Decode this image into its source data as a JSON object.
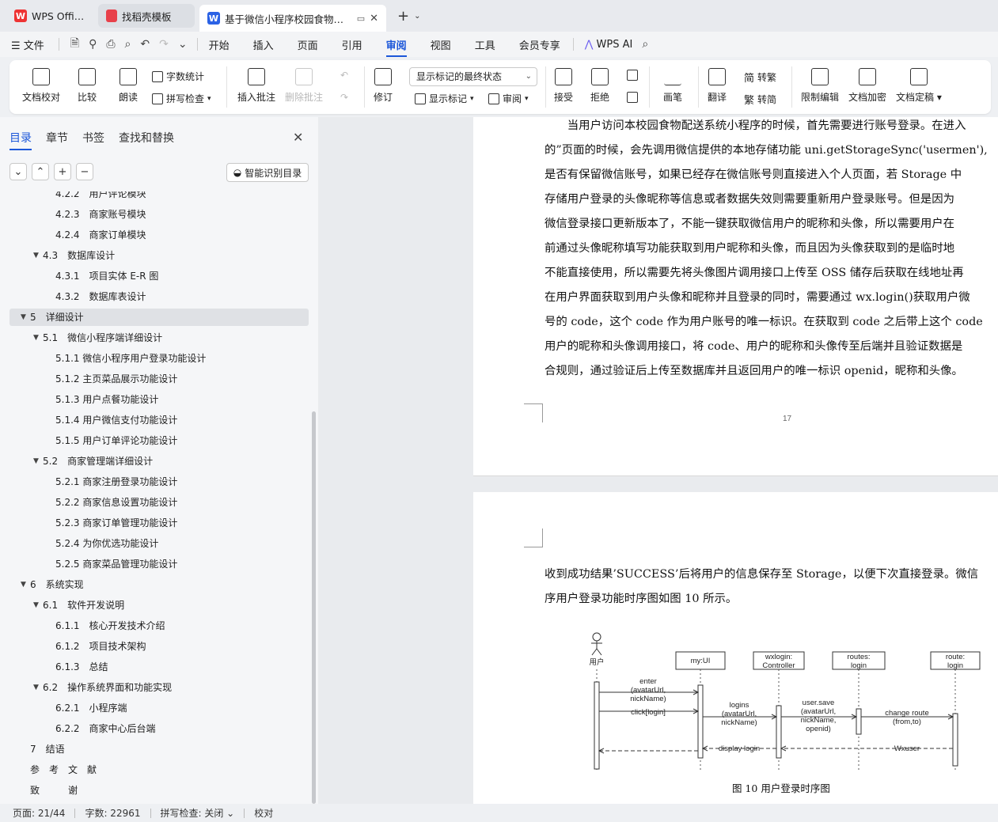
{
  "tabs": {
    "wps_office": "WPS Office",
    "template": "找稻壳模板",
    "document": "基于微信小程序校园食物配送系统"
  },
  "menubar": {
    "file": "文件",
    "menus": [
      "开始",
      "插入",
      "页面",
      "引用",
      "审阅",
      "视图",
      "工具",
      "会员专享"
    ],
    "active_menu": "审阅",
    "wps_ai": "WPS AI"
  },
  "ribbon": {
    "doc_check": "文档校对",
    "compare": "比较",
    "read_aloud": "朗读",
    "word_count": "字数统计",
    "spell_check": "拼写检查",
    "insert_comment": "插入批注",
    "delete_comment": "删除批注",
    "track_changes": "修订",
    "markup_state": "显示标记的最终状态",
    "show_markup": "显示标记",
    "review": "审阅",
    "accept": "接受",
    "reject": "拒绝",
    "pen": "画笔",
    "translate": "翻译",
    "to_traditional": "转繁",
    "to_simplified": "转简",
    "restrict_edit": "限制编辑",
    "doc_encrypt": "文档加密",
    "doc_finalize": "文档定稿"
  },
  "leftpanel": {
    "tabs": [
      "目录",
      "章节",
      "书签",
      "查找和替换"
    ],
    "active_tab": "目录",
    "smart_toc": "智能识别目录",
    "toc": [
      {
        "num": "4.2.2",
        "title": "用户评论模块",
        "level": 3
      },
      {
        "num": "4.2.3",
        "title": "商家账号模块",
        "level": 3
      },
      {
        "num": "4.2.4",
        "title": "商家订单模块",
        "level": 3
      },
      {
        "num": "4.3",
        "title": "数据库设计",
        "level": 2
      },
      {
        "num": "4.3.1",
        "title": "项目实体 E-R 图",
        "level": 3
      },
      {
        "num": "4.3.2",
        "title": "数据库表设计",
        "level": 3
      },
      {
        "num": "5",
        "title": "详细设计",
        "level": 1
      },
      {
        "num": "5.1",
        "title": "微信小程序端详细设计",
        "level": 2
      },
      {
        "num": "5.1.1",
        "title": "微信小程序用户登录功能设计",
        "level": 3
      },
      {
        "num": "5.1.2",
        "title": "主页菜品展示功能设计",
        "level": 3
      },
      {
        "num": "5.1.3",
        "title": "用户点餐功能设计",
        "level": 3
      },
      {
        "num": "5.1.4",
        "title": "用户微信支付功能设计",
        "level": 3
      },
      {
        "num": "5.1.5",
        "title": "用户订单评论功能设计",
        "level": 3
      },
      {
        "num": "5.2",
        "title": "商家管理端详细设计",
        "level": 2
      },
      {
        "num": "5.2.1",
        "title": "商家注册登录功能设计",
        "level": 3
      },
      {
        "num": "5.2.2",
        "title": "商家信息设置功能设计",
        "level": 3
      },
      {
        "num": "5.2.3",
        "title": "商家订单管理功能设计",
        "level": 3
      },
      {
        "num": "5.2.4",
        "title": "为你优选功能设计",
        "level": 3
      },
      {
        "num": "5.2.5",
        "title": "商家菜品管理功能设计",
        "level": 3
      },
      {
        "num": "6",
        "title": "系统实现",
        "level": 1
      },
      {
        "num": "6.1",
        "title": "软件开发说明",
        "level": 2
      },
      {
        "num": "6.1.1",
        "title": "核心开发技术介绍",
        "level": 3
      },
      {
        "num": "6.1.2",
        "title": "项目技术架构",
        "level": 3
      },
      {
        "num": "6.1.3",
        "title": "总结",
        "level": 3
      },
      {
        "num": "6.2",
        "title": "操作系统界面和功能实现",
        "level": 2
      },
      {
        "num": "6.2.1",
        "title": "小程序端",
        "level": 3
      },
      {
        "num": "6.2.2",
        "title": "商家中心后台端",
        "level": 3
      },
      {
        "num": "7",
        "title": "结语",
        "level": 1
      },
      {
        "num": "",
        "title": "参　考　文　献",
        "level": 1
      },
      {
        "num": "",
        "title": "致　　　谢",
        "level": 1
      }
    ]
  },
  "document": {
    "page1_lines": [
      "　　当用户访问本校园食物配送系统小程序的时候，首先需要进行账号登录。在进入",
      "的”页面的时候，会先调用微信提供的本地存储功能 uni.getStorageSync('usermen'),",
      "是否有保留微信账号，如果已经存在微信账号则直接进入个人页面，若 Storage 中",
      "存储用户登录的头像昵称等信息或者数据失效则需要重新用户登录账号。但是因为",
      "微信登录接口更新版本了，不能一键获取微信用户的昵称和头像，所以需要用户在",
      "前通过头像昵称填写功能获取到用户昵称和头像，而且因为头像获取到的是临时地",
      "不能直接使用，所以需要先将头像图片调用接口上传至 OSS 储存后获取在线地址再",
      "在用户界面获取到用户头像和昵称并且登录的同时，需要通过 wx.login()获取用户微",
      "号的 code，这个 code 作为用户账号的唯一标识。在获取到 code 之后带上这个 code",
      "用户的昵称和头像调用接口，将 code、用户的昵称和头像传至后端并且验证数据是",
      "合规则，通过验证后上传至数据库并且返回用户的唯一标识 openid，昵称和头像。"
    ],
    "page1_number": "17",
    "page2_lines": [
      "收到成功结果’SUCCESS’后将用户的信息保存至 Storage，以便下次直接登录。微信",
      "序用户登录功能时序图如图 10 所示。"
    ],
    "figure_caption": "图 10  用户登录时序图",
    "diagram": {
      "actor": "用户",
      "lifelines": [
        "my:UI",
        "wxlogin:\nController",
        "routes:\nlogin",
        "route:\nlogin"
      ],
      "messages": {
        "enter": "enter\n(avatarUrl,\nnickName)",
        "click": "click[login]",
        "logins": "logins\n(avatarUrl,\nnickName)",
        "usersave": "user.save\n(avatarUrl,\nnickName,\nopenid)",
        "changeroute": "change route\n(from,to)",
        "displaylogin": "display login",
        "wxuser": "Wxuser"
      }
    }
  },
  "statusbar": {
    "page": "页面: 21/44",
    "words": "字数: 22961",
    "spell": "拼写检查: 关闭",
    "proof": "校对"
  }
}
